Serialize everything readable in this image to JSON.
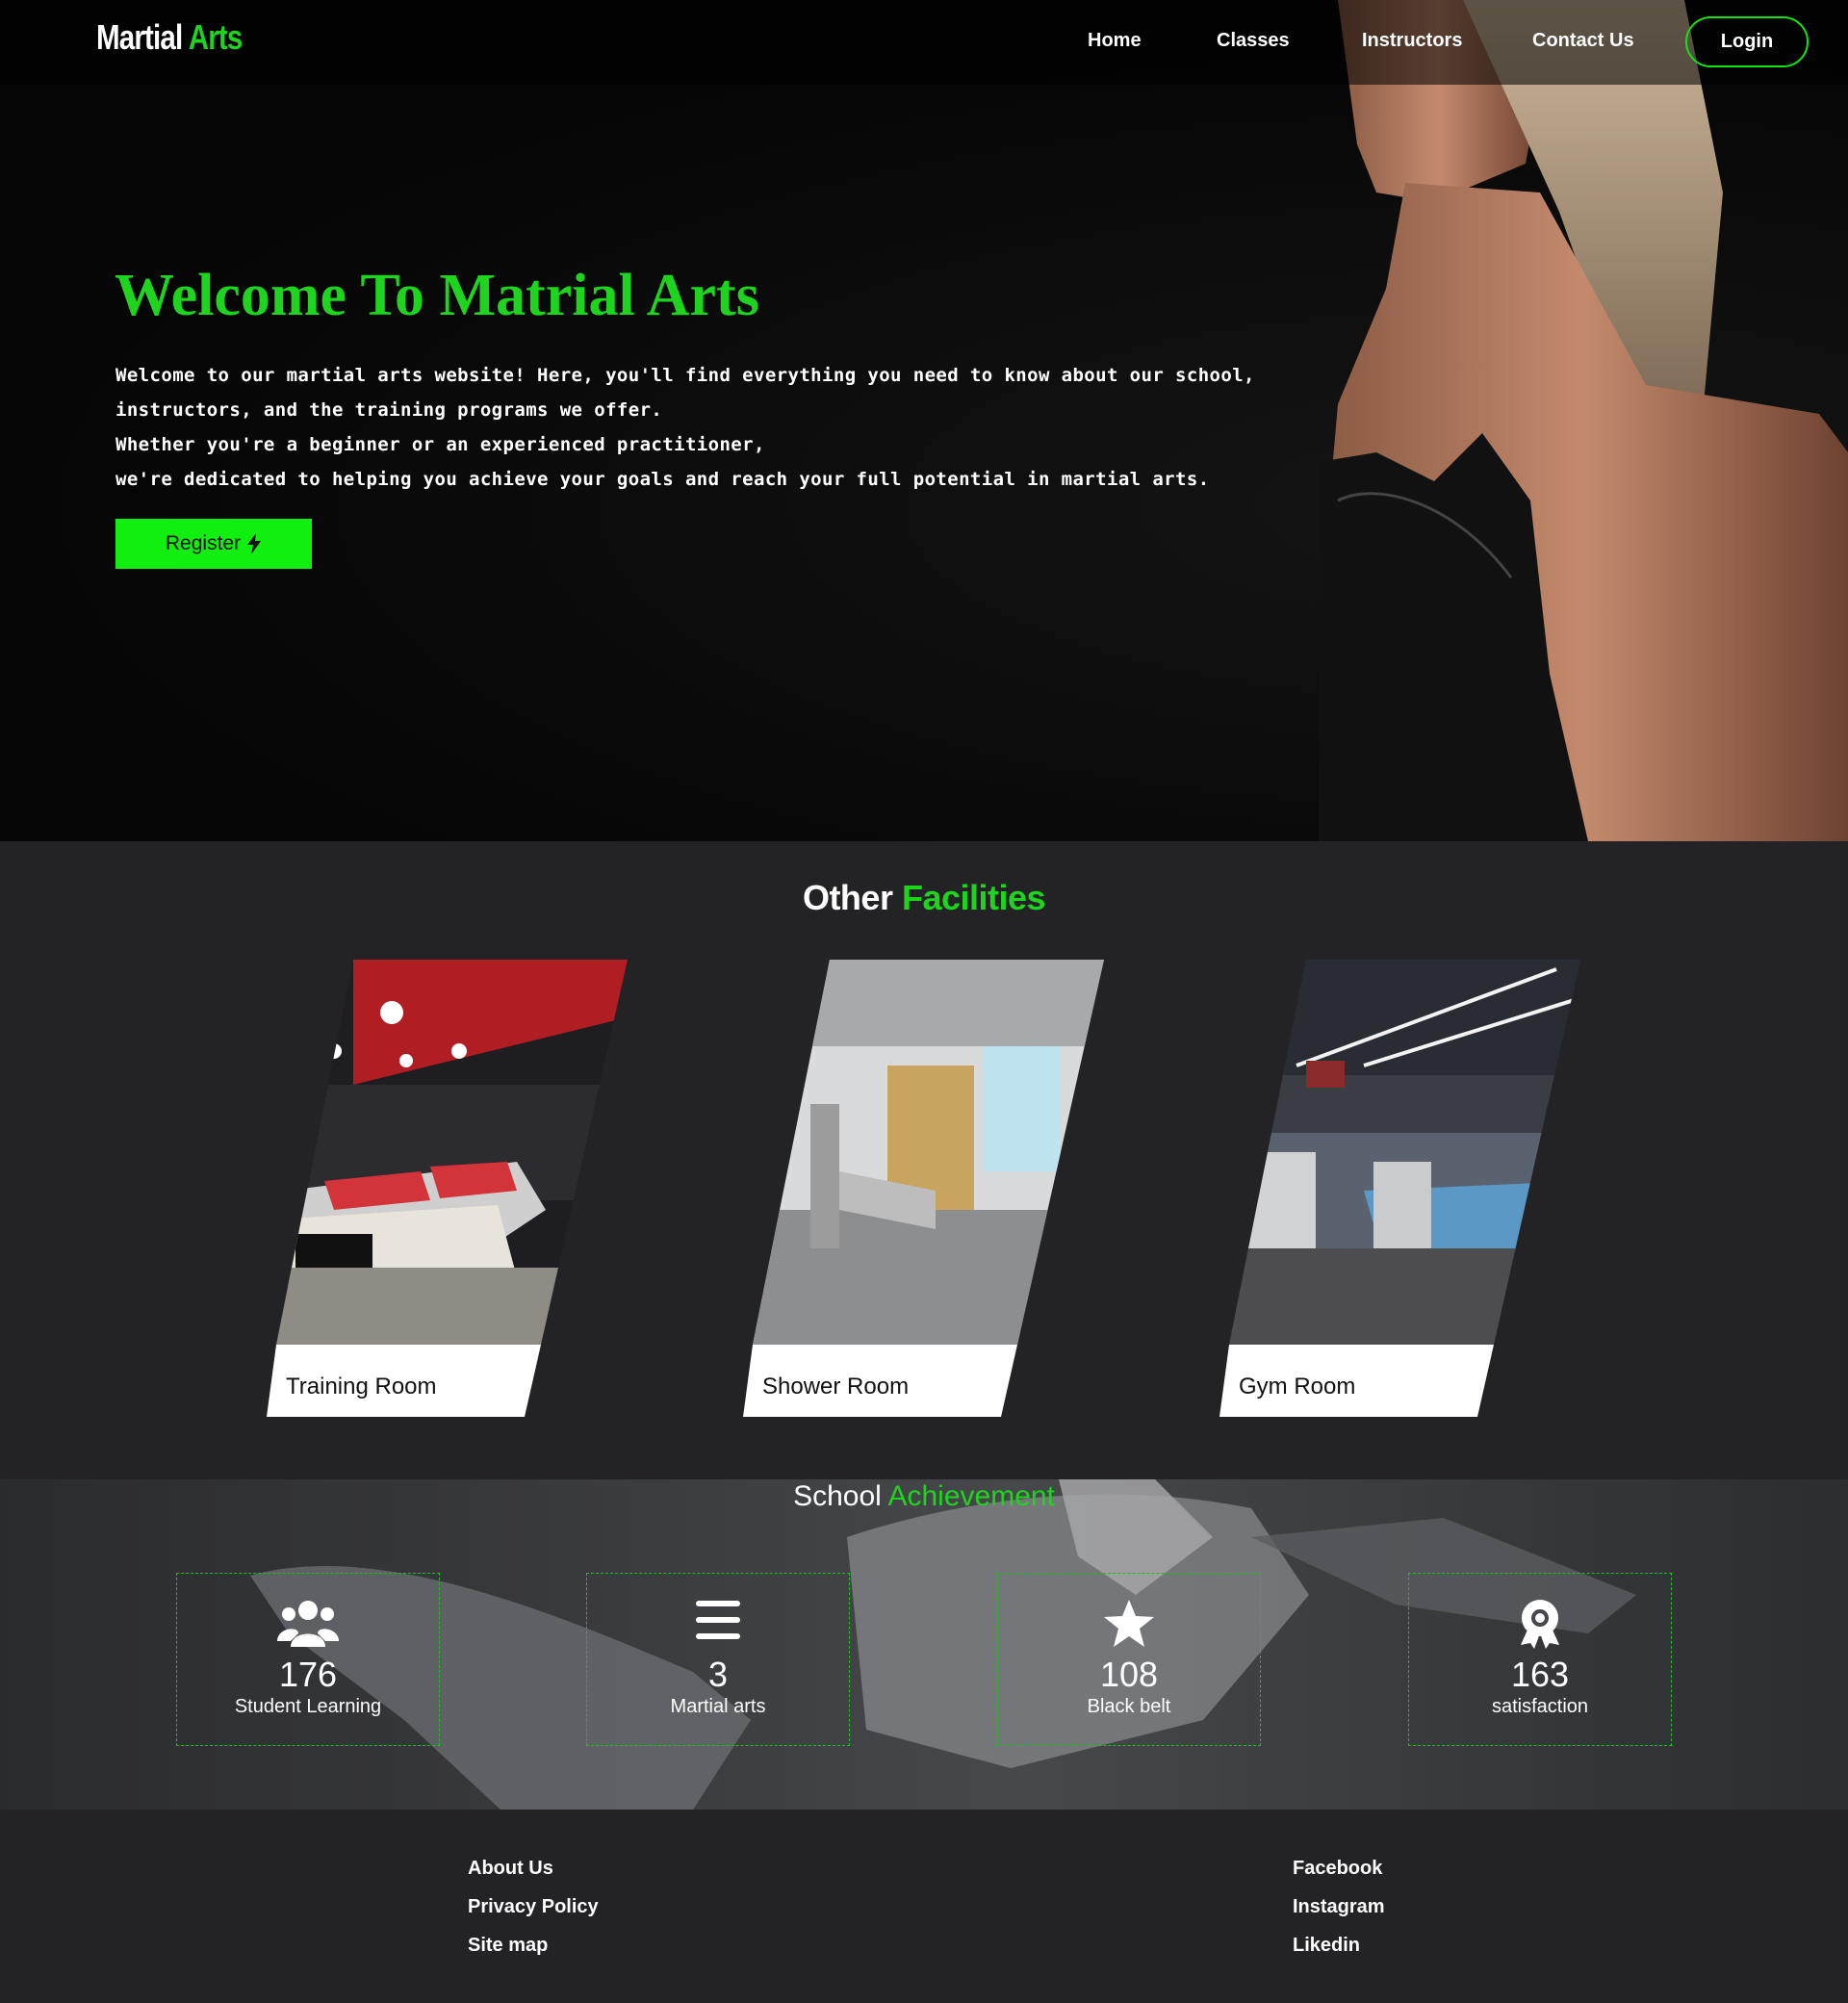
{
  "brand": {
    "part1": "Martial",
    "part2": "Arts"
  },
  "nav": {
    "links": [
      "Home",
      "Classes",
      "Instructors",
      "Contact Us"
    ],
    "login_label": "Login"
  },
  "hero": {
    "title": "Welcome To Matrial Arts",
    "lines": [
      "Welcome to our martial arts website! Here, you'll find everything you need to know about our school,",
      "instructors, and the training programs we offer.",
      "Whether you're a beginner or an experienced practitioner,",
      "we're dedicated to helping you achieve your goals and reach your full potential in martial arts."
    ],
    "register_label": "Register",
    "register_icon": "lightning-bolt-icon"
  },
  "facilities": {
    "title_white": "Other",
    "title_green": "Facilities",
    "cards": [
      {
        "label": "Training Room"
      },
      {
        "label": "Shower Room"
      },
      {
        "label": "Gym Room"
      }
    ]
  },
  "achievements": {
    "title_white": "School",
    "title_green": "Achievement",
    "stats": [
      {
        "icon": "users-icon",
        "value": "176",
        "label": "Student Learning"
      },
      {
        "icon": "menu-bars-icon",
        "value": "3",
        "label": "Martial arts"
      },
      {
        "icon": "star-icon",
        "value": "108",
        "label": "Black belt"
      },
      {
        "icon": "award-icon",
        "value": "163",
        "label": "satisfaction"
      }
    ]
  },
  "footer": {
    "left_links": [
      "About Us",
      "Privacy Policy",
      "Site map"
    ],
    "right_links": [
      "Facebook",
      "Instagram",
      "Likedin"
    ]
  },
  "colors": {
    "accent": "#1ed41e",
    "button_green": "#10ef10",
    "background": "#232326"
  }
}
